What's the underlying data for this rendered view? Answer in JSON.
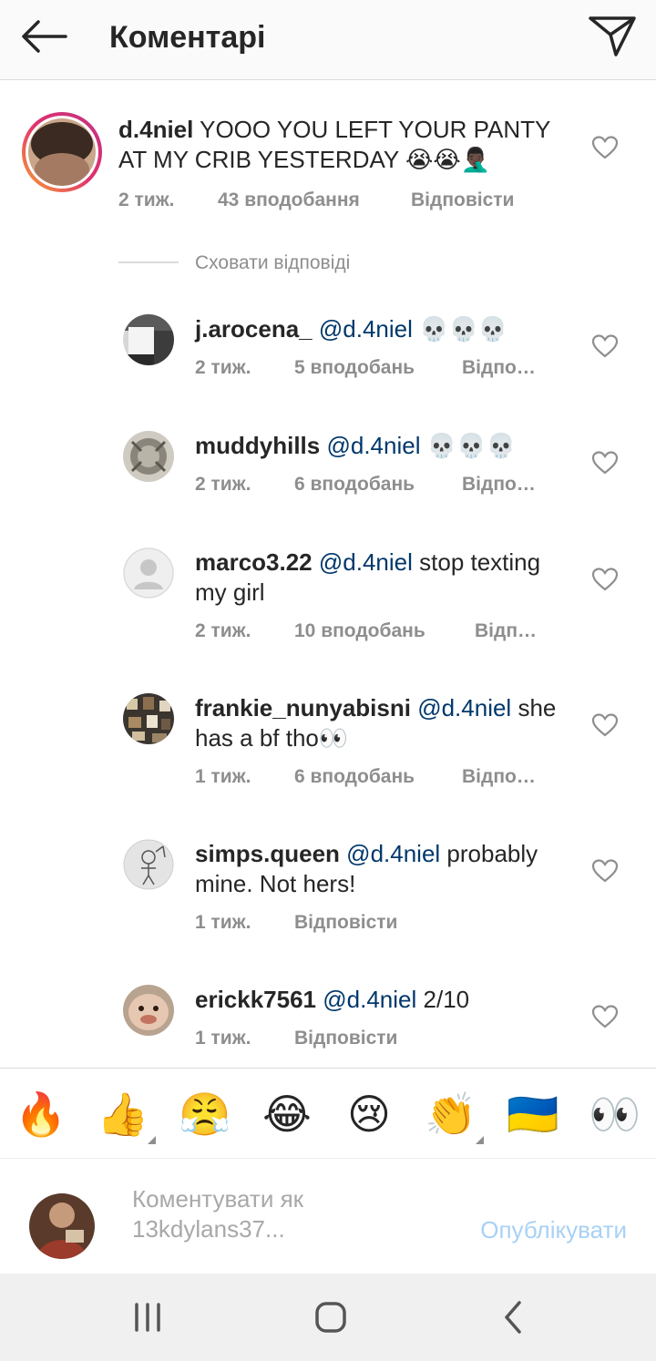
{
  "header": {
    "title": "Коментарі"
  },
  "main_comment": {
    "username": "d.4niel",
    "text": " YOOO YOU LEFT YOUR PANTY AT MY CRIB YESTERDAY 😭😭🤦🏿‍♂️",
    "time": "2 тиж.",
    "likes": "43 вподобання",
    "reply": "Відповісти"
  },
  "hide_replies": "Сховати відповіді",
  "replies": [
    {
      "username": "j.arocena_",
      "mention": "@d.4niel",
      "text": " 💀💀💀",
      "time": "2 тиж.",
      "likes": "5 вподобань",
      "reply": "Відпо…"
    },
    {
      "username": "muddyhills",
      "mention": "@d.4niel",
      "text": " 💀💀💀",
      "time": "2 тиж.",
      "likes": "6 вподобань",
      "reply": "Відпо…"
    },
    {
      "username": "marco3.22",
      "mention": "@d.4niel",
      "text": " stop texting my girl",
      "time": "2 тиж.",
      "likes": "10 вподобань",
      "reply": "Відп…"
    },
    {
      "username": "frankie_nunyabisni",
      "mention": "@d.4niel",
      "text": " she has a bf tho👀",
      "time": "1 тиж.",
      "likes": "6 вподобань",
      "reply": "Відпо…"
    },
    {
      "username": "simps.queen",
      "mention": "@d.4niel",
      "text": " probably mine.  Not hers!",
      "time": "1 тиж.",
      "likes": "",
      "reply": "Відповісти"
    },
    {
      "username": "erickk7561",
      "mention": "@d.4niel",
      "text": " 2/10",
      "time": "1 тиж.",
      "likes": "",
      "reply": "Відповісти"
    }
  ],
  "emoji_bar": [
    "🔥",
    "👍",
    "😤",
    "😂",
    "😢",
    "👏",
    "🇺🇦",
    "👀"
  ],
  "compose": {
    "placeholder": "Коментувати як 13kdylans37...",
    "publish": "Опублікувати"
  },
  "colors": {
    "mention": "#00376b",
    "meta": "#8e8e8e",
    "publish": "#a8d1f5"
  }
}
